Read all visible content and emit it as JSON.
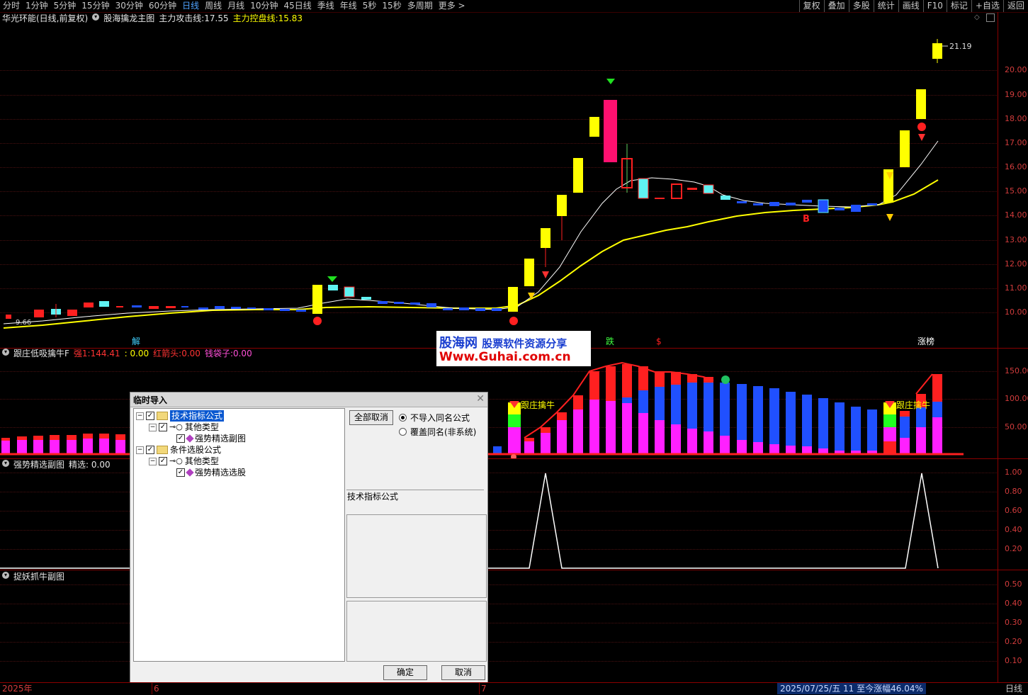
{
  "toolbar": {
    "periods": [
      "分时",
      "1分钟",
      "5分钟",
      "15分钟",
      "30分钟",
      "60分钟",
      "日线",
      "周线",
      "月线",
      "10分钟",
      "45日线",
      "季线",
      "年线",
      "5秒",
      "15秒",
      "多周期",
      "更多 >"
    ],
    "active_period": "日线",
    "right_buttons": [
      "复权",
      "叠加",
      "多股",
      "统计",
      "画线",
      "F10",
      "标记",
      "+自选",
      "返回"
    ]
  },
  "main_panel": {
    "stock": "华光环能(日线,前复权)",
    "indicator": "股海擒龙主图",
    "attack_line_label": "主力攻击线:",
    "attack_line_value": "17.55",
    "control_line_label": "主力控盘线:",
    "control_line_value": "15.83",
    "price_ticks": [
      "20.00",
      "19.00",
      "18.00",
      "17.00",
      "16.00",
      "15.00",
      "14.00",
      "13.00",
      "12.00",
      "11.00",
      "10.00"
    ],
    "high_label": "21.19",
    "low_label": "9.66",
    "signal_b": "B",
    "marks": {
      "jie": "解",
      "die": "跌",
      "s": "$",
      "zhangbang": "涨榜"
    }
  },
  "panel2": {
    "title": "跟庄低吸擒牛F",
    "qiang_label": "强1:",
    "qiang_value": "144.41",
    "sep_value": ": 0.00",
    "hongjiantou_label": "红箭头:",
    "hongjiantou_value": "0.00",
    "qiandaizi_label": "钱袋子:",
    "qiandaizi_value": "0.00",
    "ticks": [
      "150.00",
      "100.00",
      "50.00"
    ],
    "annotation": "跟庄擒牛"
  },
  "panel3": {
    "title": "强势精选副图",
    "jingxuan_label": "精选:",
    "jingxuan_value": "0.00",
    "ticks": [
      "1.00",
      "0.80",
      "0.60",
      "0.40",
      "0.20"
    ]
  },
  "panel4": {
    "title": "捉妖抓牛副图",
    "ticks": [
      "0.50",
      "0.40",
      "0.30",
      "0.20",
      "0.10"
    ]
  },
  "watermark": {
    "line1_a": "股海网",
    "line1_b": "股票软件资源分享",
    "line2": "Www.Guhai.com.cn"
  },
  "dialog": {
    "title": "临时导入",
    "tree": {
      "node1": "技术指标公式",
      "node1_child": "其他类型",
      "node1_leaf": "强势精选副图",
      "node2": "条件选股公式",
      "node2_child": "其他类型",
      "node2_leaf": "强势精选选股"
    },
    "cancel_all_button": "全部取消",
    "radio_skip": "不导入同名公式",
    "radio_overwrite": "覆盖同名(非系统)",
    "info_label": "技术指标公式",
    "ok_button": "确定",
    "cancel_button": "取消"
  },
  "bottom": {
    "year_label": "2025年",
    "month6": "6",
    "month7": "7",
    "status": "2025/07/25/五 11 至今涨幅46.04%",
    "period": "日线"
  }
}
